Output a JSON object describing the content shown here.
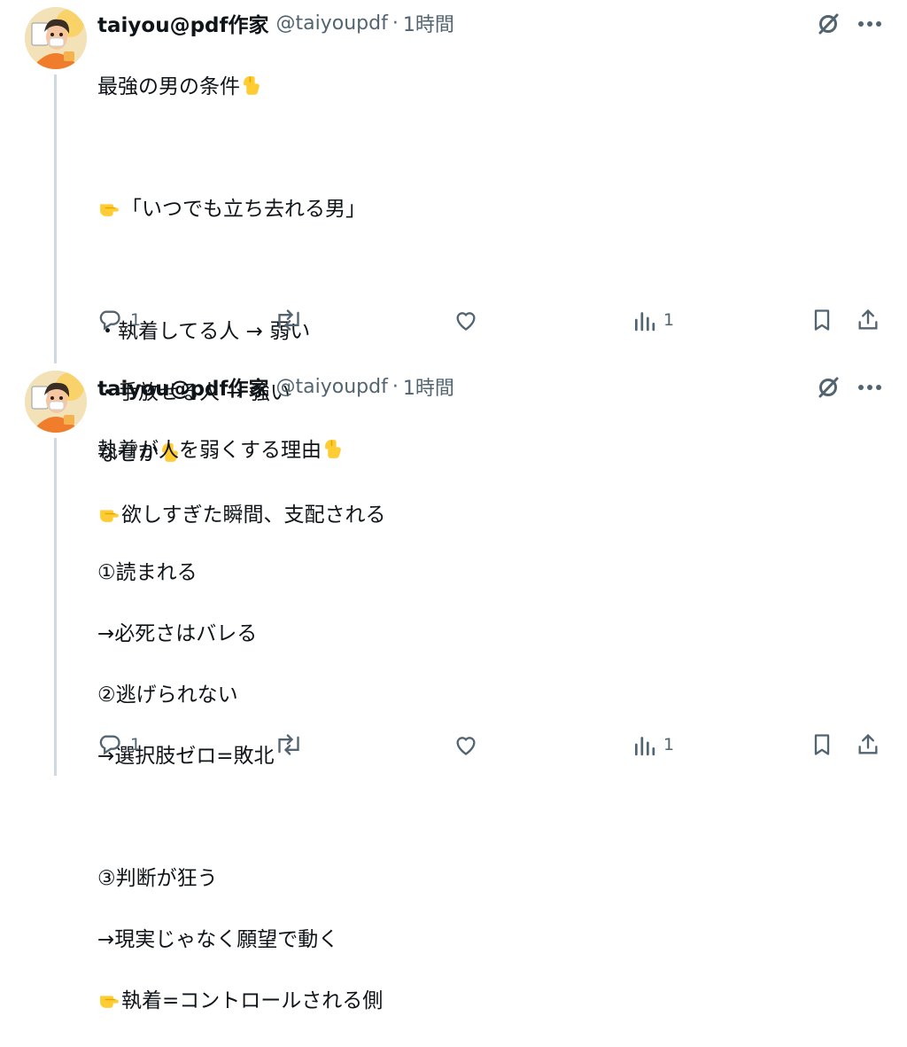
{
  "tweets": [
    {
      "author": {
        "name": "taiyou@pdf作家",
        "handle": "@taiyoupdf",
        "separator": "·",
        "time": "1時間"
      },
      "lines": [
        "最強の男の条件",
        "",
        "「いつでも立ち去れる男」",
        "",
        "・執着してる人 → 弱い",
        "・手放せる人 → 強い",
        "なぜか",
        "欲しすぎた瞬間、支配される"
      ],
      "stats": {
        "replies": "1",
        "retweets": "",
        "likes": "",
        "views": "1"
      }
    },
    {
      "author": {
        "name": "taiyou@pdf作家",
        "handle": "@taiyoupdf",
        "separator": "·",
        "time": "1時間"
      },
      "lines": [
        "執着が人を弱くする理由",
        "",
        "①読まれる",
        "→必死さはバレる",
        "②逃げられない",
        "→選択肢ゼロ=敗北",
        "",
        "③判断が狂う",
        "→現実じゃなく願望で動く",
        "執着=コントロールされる側"
      ],
      "stats": {
        "replies": "1",
        "retweets": "",
        "likes": "",
        "views": "1"
      }
    }
  ],
  "icons": [
    "avatar",
    "grok-icon",
    "more-icon",
    "reply-icon",
    "retweet-icon",
    "like-icon",
    "views-icon",
    "bookmark-icon",
    "share-icon",
    "hand-down-emoji",
    "hand-right-emoji"
  ]
}
